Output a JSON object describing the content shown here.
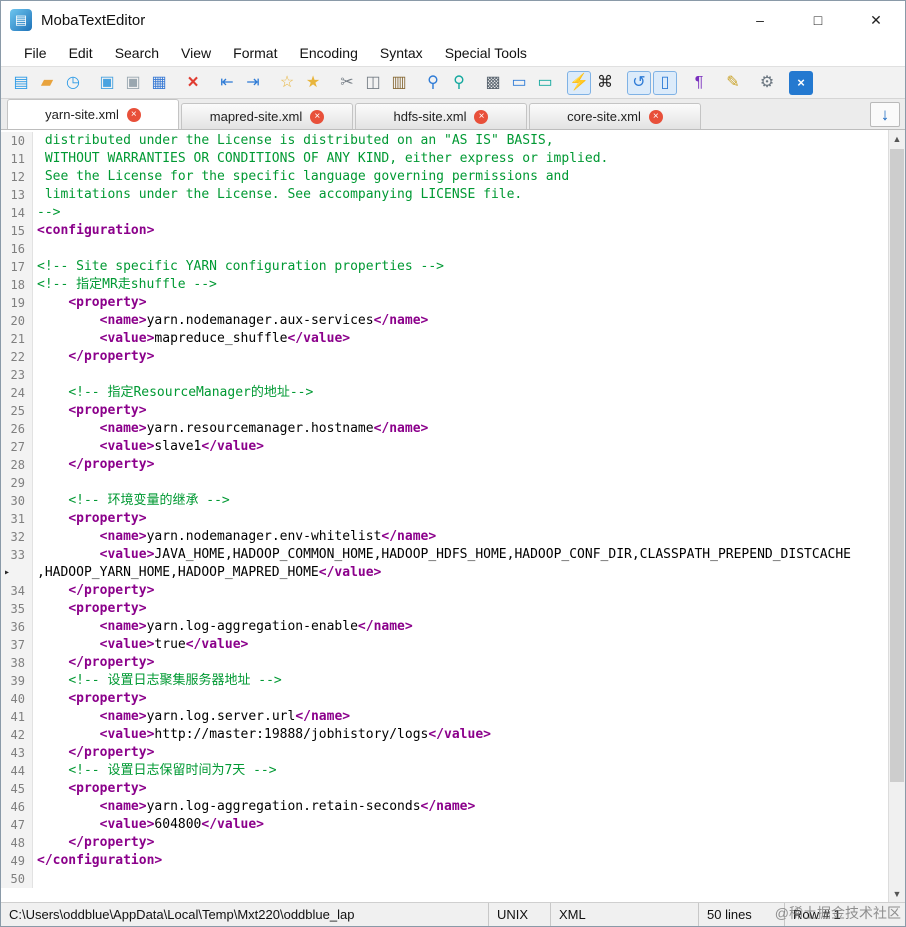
{
  "window": {
    "title": "MobaTextEditor",
    "controls": {
      "minimize": "–",
      "maximize": "□",
      "close": "✕"
    }
  },
  "menu": {
    "items": [
      "File",
      "Edit",
      "Search",
      "View",
      "Format",
      "Encoding",
      "Syntax",
      "Special Tools"
    ]
  },
  "toolbar": {
    "icons": [
      {
        "name": "new-file-icon",
        "glyph": "▤",
        "color": "#2e9be6"
      },
      {
        "name": "open-folder-icon",
        "glyph": "▰",
        "color": "#e8a33d"
      },
      {
        "name": "recent-files-icon",
        "glyph": "◷",
        "color": "#2e9be6"
      },
      {
        "name": "save-icon",
        "glyph": "▣",
        "color": "#4aa3e0",
        "grp": true
      },
      {
        "name": "save-all-icon",
        "glyph": "▣",
        "color": "#9aa7b0"
      },
      {
        "name": "print-icon",
        "glyph": "▦",
        "color": "#3a7bd5"
      },
      {
        "name": "close-file-icon",
        "glyph": "×",
        "color": "#e03c31",
        "grp": true,
        "big": true
      },
      {
        "name": "outdent-icon",
        "glyph": "⇤",
        "color": "#2e7bd6",
        "grp": true
      },
      {
        "name": "indent-icon",
        "glyph": "⇥",
        "color": "#2e7bd6"
      },
      {
        "name": "add-bookmark-icon",
        "glyph": "☆",
        "color": "#e8b53d",
        "grp": true
      },
      {
        "name": "bookmark-icon",
        "glyph": "★",
        "color": "#e8b53d"
      },
      {
        "name": "cut-icon",
        "glyph": "✂",
        "color": "#777f87",
        "grp": true
      },
      {
        "name": "copy-icon",
        "glyph": "◫",
        "color": "#777f87"
      },
      {
        "name": "paste-icon",
        "glyph": "▥",
        "color": "#8a6d3b"
      },
      {
        "name": "search-icon",
        "glyph": "⚲",
        "color": "#2e7bd6",
        "grp": true
      },
      {
        "name": "replace-icon",
        "glyph": "⚲",
        "color": "#13a89e"
      },
      {
        "name": "select-all-icon",
        "glyph": "▩",
        "color": "#5a6570",
        "grp": true
      },
      {
        "name": "terminal-icon",
        "glyph": "▭",
        "color": "#2e7bd6"
      },
      {
        "name": "remote-screen-icon",
        "glyph": "▭",
        "color": "#13a89e"
      },
      {
        "name": "syntax-highlight-icon",
        "glyph": "⚡",
        "color": "#2e9be6",
        "active": true,
        "grp": true
      },
      {
        "name": "apple-icon",
        "glyph": "⌘",
        "color": "#222222"
      },
      {
        "name": "undo-icon",
        "glyph": "↺",
        "color": "#2e7bd6",
        "active": true,
        "grp": true
      },
      {
        "name": "mobile-view-icon",
        "glyph": "▯",
        "color": "#2e7bd6",
        "active": true
      },
      {
        "name": "paragraph-marks-icon",
        "glyph": "¶",
        "color": "#7a2fbe",
        "grp": true
      },
      {
        "name": "pen-icon",
        "glyph": "✎",
        "color": "#c9a227",
        "grp": true
      },
      {
        "name": "settings-gears-icon",
        "glyph": "⚙",
        "color": "#6b7680",
        "grp": true
      },
      {
        "name": "exit-icon",
        "glyph": "×",
        "color": "#ffffff",
        "bg": "#2479d0",
        "grp": true
      }
    ]
  },
  "tabs": {
    "arrow_glyph": "↓",
    "items": [
      {
        "label": "yarn-site.xml",
        "active": true
      },
      {
        "label": "mapred-site.xml",
        "active": false
      },
      {
        "label": "hdfs-site.xml",
        "active": false
      },
      {
        "label": "core-site.xml",
        "active": false
      }
    ]
  },
  "editor": {
    "scrollbar": {
      "up": "▲",
      "down": "▼"
    },
    "rows": [
      {
        "num": "10",
        "s": [
          {
            "k": "c",
            "v": " distributed under the License is distributed on an \"AS IS\" BASIS,"
          }
        ]
      },
      {
        "num": "11",
        "s": [
          {
            "k": "c",
            "v": " WITHOUT WARRANTIES OR CONDITIONS OF ANY KIND, either express or implied."
          }
        ]
      },
      {
        "num": "12",
        "s": [
          {
            "k": "c",
            "v": " See the License for the specific language governing permissions and"
          }
        ]
      },
      {
        "num": "13",
        "s": [
          {
            "k": "c",
            "v": " limitations under the License. See accompanying LICENSE file."
          }
        ]
      },
      {
        "num": "14",
        "s": [
          {
            "k": "c",
            "v": "-->"
          }
        ]
      },
      {
        "num": "15",
        "s": [
          {
            "k": "t",
            "v": "<configuration>"
          }
        ]
      },
      {
        "num": "16",
        "s": []
      },
      {
        "num": "17",
        "s": [
          {
            "k": "c",
            "v": "<!-- Site specific YARN configuration properties -->"
          }
        ]
      },
      {
        "num": "18",
        "s": [
          {
            "k": "c",
            "v": "<!-- 指定MR走shuffle -->"
          }
        ]
      },
      {
        "num": "19",
        "s": [
          {
            "k": "x",
            "v": "    "
          },
          {
            "k": "t",
            "v": "<property>"
          }
        ]
      },
      {
        "num": "20",
        "s": [
          {
            "k": "x",
            "v": "        "
          },
          {
            "k": "t",
            "v": "<name>"
          },
          {
            "k": "x",
            "v": "yarn.nodemanager.aux-services"
          },
          {
            "k": "t",
            "v": "</name>"
          }
        ]
      },
      {
        "num": "21",
        "s": [
          {
            "k": "x",
            "v": "        "
          },
          {
            "k": "t",
            "v": "<value>"
          },
          {
            "k": "x",
            "v": "mapreduce_shuffle"
          },
          {
            "k": "t",
            "v": "</value>"
          }
        ]
      },
      {
        "num": "22",
        "s": [
          {
            "k": "x",
            "v": "    "
          },
          {
            "k": "t",
            "v": "</property>"
          }
        ]
      },
      {
        "num": "23",
        "s": []
      },
      {
        "num": "24",
        "s": [
          {
            "k": "x",
            "v": "    "
          },
          {
            "k": "c",
            "v": "<!-- 指定ResourceManager的地址-->"
          }
        ]
      },
      {
        "num": "25",
        "s": [
          {
            "k": "x",
            "v": "    "
          },
          {
            "k": "t",
            "v": "<property>"
          }
        ]
      },
      {
        "num": "26",
        "s": [
          {
            "k": "x",
            "v": "        "
          },
          {
            "k": "t",
            "v": "<name>"
          },
          {
            "k": "x",
            "v": "yarn.resourcemanager.hostname"
          },
          {
            "k": "t",
            "v": "</name>"
          }
        ]
      },
      {
        "num": "27",
        "s": [
          {
            "k": "x",
            "v": "        "
          },
          {
            "k": "t",
            "v": "<value>"
          },
          {
            "k": "x",
            "v": "slave1"
          },
          {
            "k": "t",
            "v": "</value>"
          }
        ]
      },
      {
        "num": "28",
        "s": [
          {
            "k": "x",
            "v": "    "
          },
          {
            "k": "t",
            "v": "</property>"
          }
        ]
      },
      {
        "num": "29",
        "s": []
      },
      {
        "num": "30",
        "s": [
          {
            "k": "x",
            "v": "    "
          },
          {
            "k": "c",
            "v": "<!-- 环境变量的继承 -->"
          }
        ]
      },
      {
        "num": "31",
        "s": [
          {
            "k": "x",
            "v": "    "
          },
          {
            "k": "t",
            "v": "<property>"
          }
        ]
      },
      {
        "num": "32",
        "s": [
          {
            "k": "x",
            "v": "        "
          },
          {
            "k": "t",
            "v": "<name>"
          },
          {
            "k": "x",
            "v": "yarn.nodemanager.env-whitelist"
          },
          {
            "k": "t",
            "v": "</name>"
          }
        ]
      },
      {
        "num": "33",
        "s": [
          {
            "k": "x",
            "v": "        "
          },
          {
            "k": "t",
            "v": "<value>"
          },
          {
            "k": "x",
            "v": "JAVA_HOME,HADOOP_COMMON_HOME,HADOOP_HDFS_HOME,HADOOP_CONF_DIR,CLASSPATH_PREPEND_DISTCACHE"
          }
        ]
      },
      {
        "num": "",
        "wrap": true,
        "s": [
          {
            "k": "x",
            "v": ",HADOOP_YARN_HOME,HADOOP_MAPRED_HOME"
          },
          {
            "k": "t",
            "v": "</value>"
          }
        ]
      },
      {
        "num": "34",
        "s": [
          {
            "k": "x",
            "v": "    "
          },
          {
            "k": "t",
            "v": "</property>"
          }
        ]
      },
      {
        "num": "35",
        "s": [
          {
            "k": "x",
            "v": "    "
          },
          {
            "k": "t",
            "v": "<property>"
          }
        ]
      },
      {
        "num": "36",
        "s": [
          {
            "k": "x",
            "v": "        "
          },
          {
            "k": "t",
            "v": "<name>"
          },
          {
            "k": "x",
            "v": "yarn.log-aggregation-enable"
          },
          {
            "k": "t",
            "v": "</name>"
          }
        ]
      },
      {
        "num": "37",
        "s": [
          {
            "k": "x",
            "v": "        "
          },
          {
            "k": "t",
            "v": "<value>"
          },
          {
            "k": "x",
            "v": "true"
          },
          {
            "k": "t",
            "v": "</value>"
          }
        ]
      },
      {
        "num": "38",
        "s": [
          {
            "k": "x",
            "v": "    "
          },
          {
            "k": "t",
            "v": "</property>"
          }
        ]
      },
      {
        "num": "39",
        "s": [
          {
            "k": "x",
            "v": "    "
          },
          {
            "k": "c",
            "v": "<!-- 设置日志聚集服务器地址 -->"
          }
        ]
      },
      {
        "num": "40",
        "s": [
          {
            "k": "x",
            "v": "    "
          },
          {
            "k": "t",
            "v": "<property>"
          }
        ]
      },
      {
        "num": "41",
        "s": [
          {
            "k": "x",
            "v": "        "
          },
          {
            "k": "t",
            "v": "<name>"
          },
          {
            "k": "x",
            "v": "yarn.log.server.url"
          },
          {
            "k": "t",
            "v": "</name>"
          }
        ]
      },
      {
        "num": "42",
        "s": [
          {
            "k": "x",
            "v": "        "
          },
          {
            "k": "t",
            "v": "<value>"
          },
          {
            "k": "x",
            "v": "http://master:19888/jobhistory/logs"
          },
          {
            "k": "t",
            "v": "</value>"
          }
        ]
      },
      {
        "num": "43",
        "s": [
          {
            "k": "x",
            "v": "    "
          },
          {
            "k": "t",
            "v": "</property>"
          }
        ]
      },
      {
        "num": "44",
        "s": [
          {
            "k": "x",
            "v": "    "
          },
          {
            "k": "c",
            "v": "<!-- 设置日志保留时间为7天 -->"
          }
        ]
      },
      {
        "num": "45",
        "s": [
          {
            "k": "x",
            "v": "    "
          },
          {
            "k": "t",
            "v": "<property>"
          }
        ]
      },
      {
        "num": "46",
        "s": [
          {
            "k": "x",
            "v": "        "
          },
          {
            "k": "t",
            "v": "<name>"
          },
          {
            "k": "x",
            "v": "yarn.log-aggregation.retain-seconds"
          },
          {
            "k": "t",
            "v": "</name>"
          }
        ]
      },
      {
        "num": "47",
        "s": [
          {
            "k": "x",
            "v": "        "
          },
          {
            "k": "t",
            "v": "<value>"
          },
          {
            "k": "x",
            "v": "604800"
          },
          {
            "k": "t",
            "v": "</value>"
          }
        ]
      },
      {
        "num": "48",
        "s": [
          {
            "k": "x",
            "v": "    "
          },
          {
            "k": "t",
            "v": "</property>"
          }
        ]
      },
      {
        "num": "49",
        "s": [
          {
            "k": "t",
            "v": "</configuration>"
          }
        ]
      },
      {
        "num": "50",
        "s": []
      }
    ]
  },
  "status": {
    "path": "C:\\Users\\oddblue\\AppData\\Local\\Temp\\Mxt220\\oddblue_lap",
    "eol": "UNIX",
    "syntax": "XML",
    "line_count": "50 lines",
    "row": "Row # 1"
  },
  "watermark": {
    "text": "@稀土掘金技术社区"
  }
}
